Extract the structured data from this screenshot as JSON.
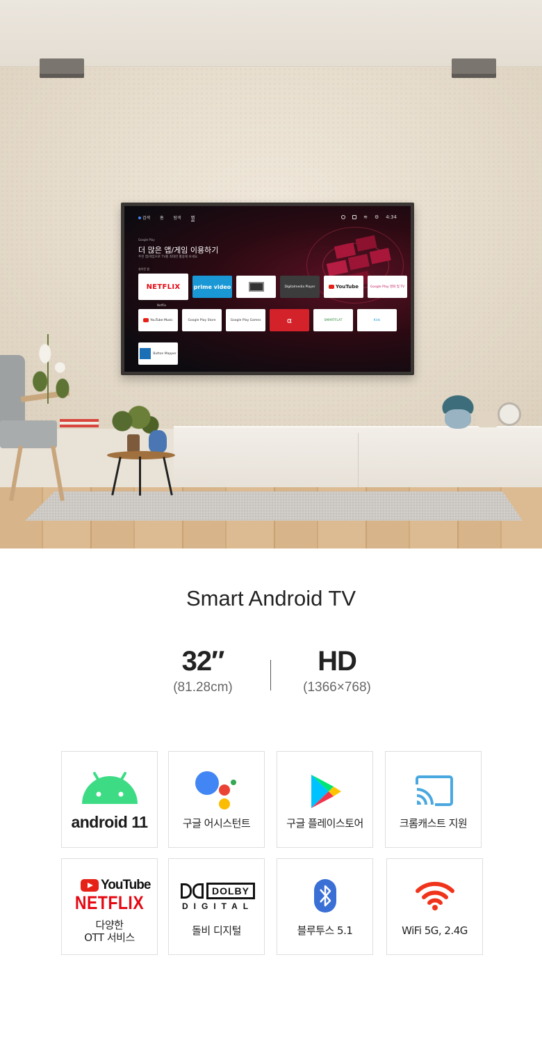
{
  "tv_ui": {
    "nav": {
      "search": "검색",
      "home": "홈",
      "explore": "탐색",
      "apps": "앱"
    },
    "clock": "4:34",
    "google_play_tag": "Google Play",
    "headline": "더 많은 앱/게임 이용하기",
    "subline": "추천 앱/게임으로 TV를 최대한 활용해 보세요.",
    "row_label": "설치된 앱",
    "row1": [
      "NETFLIX",
      "prime video",
      "",
      "Digitalmedia Player",
      "YouTube",
      "Google Play 영화 및 TV"
    ],
    "row2": [
      "YouTube Music",
      "Google Play Store",
      "Google Play Games",
      "α",
      "SMARTFLAT",
      "Kids"
    ],
    "row3": [
      "Button Mapper"
    ],
    "first_caption": "Netflix"
  },
  "product": {
    "title": "Smart Android TV",
    "specs": [
      {
        "value": "32″",
        "detail": "(81.28cm)"
      },
      {
        "value": "HD",
        "detail": "(1366×768)"
      }
    ]
  },
  "features": {
    "android": {
      "logo_text": "android 11"
    },
    "assistant": {
      "label": "구글 어시스턴트"
    },
    "play_store": {
      "label": "구글 플레이스토어"
    },
    "chromecast": {
      "label": "크롬캐스트 지원"
    },
    "ott": {
      "youtube_text": "YouTube",
      "netflix_text": "NETFLIX",
      "label_line1": "다양한",
      "label_line2": "OTT 서비스"
    },
    "dolby": {
      "brand": "DOLBY",
      "sub": "DIGITAL",
      "label": "돌비 디지털"
    },
    "bluetooth": {
      "label": "블루투스 5.1"
    },
    "wifi": {
      "label": "WiFi 5G, 2.4G"
    }
  },
  "colors": {
    "android_green": "#3ddc84",
    "netflix_red": "#e50914",
    "youtube_red": "#e62117",
    "chromecast_blue": "#4aa8e0",
    "bluetooth_blue": "#3a6fd6",
    "wifi_red": "#f0341c"
  }
}
